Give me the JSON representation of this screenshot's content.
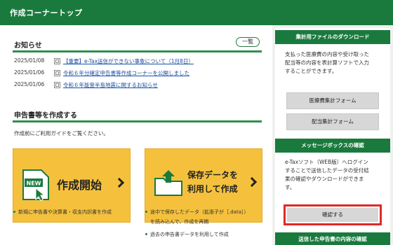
{
  "header": {
    "title": "作成コーナートップ"
  },
  "news": {
    "title": "お知らせ",
    "more_label": "一覧",
    "items": [
      {
        "date": "2025/01/08",
        "text": "【重要】e-Tax送信ができない事象について（1月8日）"
      },
      {
        "date": "2025/01/06",
        "text": "令和６年分確定申告書等作成コーナーを公開しました"
      },
      {
        "date": "2025/01/06",
        "text": "令和６年能登半島地震に関するお知らせ"
      }
    ]
  },
  "create": {
    "title": "申告書等を作成する",
    "intro": "作成前にご利用ガイドをご覧ください。",
    "start": {
      "label": "作成開始",
      "badge": "NEW",
      "bullets": [
        "新規に申告書や決算書・収支内訳書を作成"
      ]
    },
    "saved": {
      "label_line1": "保存データを",
      "label_line2": "利用して作成",
      "bullets": [
        "途中で保存したデータ（拡張子が［.data］）",
        "を読み込んで、作成を再開",
        "過去の申告書データを利用して作成"
      ]
    }
  },
  "sidebar": {
    "download": {
      "title": "集計用ファイルのダウンロード",
      "text_lines": [
        "支払った医療費の内容や受け取った",
        "配当等の内容を表計算ソフトで入力",
        "することができます。"
      ],
      "buttons": [
        "医療費集計フォーム",
        "配当集計フォーム"
      ]
    },
    "message": {
      "title": "メッセージボックスの確認",
      "text_lines": [
        "e-Taxソフト（WEB版）へログイン",
        "することで送信したデータの受付結",
        "果の確認やダウンロードができま",
        "す。"
      ],
      "confirm_label": "確認する"
    },
    "submitted": {
      "title": "送信した申告書の内容の確認"
    }
  },
  "colors": {
    "header_green": "#1a7a3e",
    "button_yellow": "#f5c13d",
    "highlight_red": "#e02828"
  }
}
